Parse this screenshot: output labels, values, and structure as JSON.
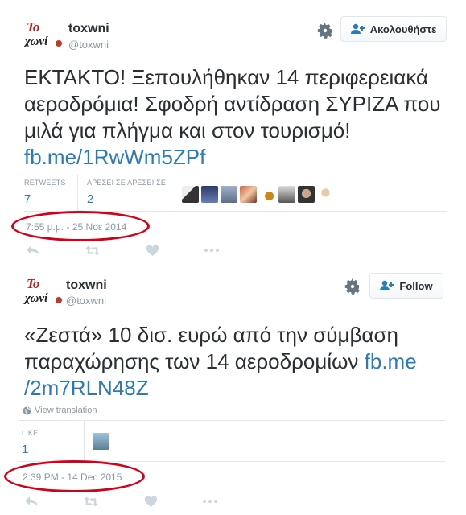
{
  "colors": {
    "link": "#2b7bb9",
    "muted": "#8899a6",
    "highlight_ellipse": "#d0021b"
  },
  "tweets": [
    {
      "author": {
        "name": "toxwni",
        "handle": "@toxwni",
        "avatar_text_top": "Το",
        "avatar_text_bottom": "χωνί"
      },
      "follow_label": "Ακολουθήστε",
      "text": "ΕΚΤΑΚΤΟ! Ξεπουλήθηκαν 14 περιφερειακά αεροδρόμια! Σφοδρή αντίδραση ΣΥΡΙΖΑ που μιλά για πλήγμα και στον τουρισμό!",
      "link": "fb.me/1RwWm5ZPf",
      "stats": [
        {
          "label": "RETWEETS",
          "value": "7"
        },
        {
          "label": "ΑΡΕΣΕΙ ΣΕ ΑΡΕΣΕΙ ΣΕ",
          "value": "2"
        }
      ],
      "liker_avatar_count": 8,
      "timestamp": "7:55 μ.μ. - 25 Νοε 2014"
    },
    {
      "author": {
        "name": "toxwni",
        "handle": "@toxwni",
        "avatar_text_top": "Το",
        "avatar_text_bottom": "χωνί"
      },
      "follow_label": "Follow",
      "text_line1": "«Ζεστά» 10 δισ. ευρώ από την σύμβαση",
      "text_line2": "παραχώρησης των 14 αεροδρομίων",
      "link_part1": "fb.me",
      "link_part2": "/2m7RLN48Z",
      "translation_label": "View translation",
      "stats": [
        {
          "label": "LIKE",
          "value": "1"
        }
      ],
      "liker_avatar_count": 1,
      "timestamp": "2:39 PM - 14 Dec 2015"
    }
  ],
  "icons": [
    "gear-icon",
    "follow-person-plus-icon",
    "reply-icon",
    "retweet-icon",
    "like-heart-icon",
    "more-icon",
    "globe-icon"
  ]
}
